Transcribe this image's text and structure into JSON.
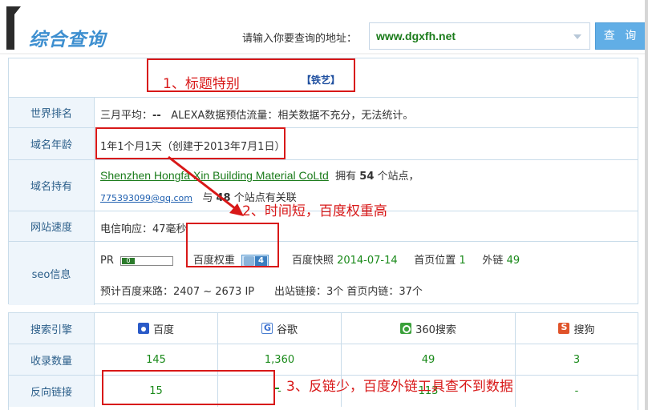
{
  "header": {
    "title": "综合查询",
    "input_label": "请输入你要查询的地址：",
    "url_value": "www.dgxfh.net",
    "query_button": "查 询"
  },
  "site_title_row": {
    "annotation": "1、标题特别",
    "tag": "【铁艺】"
  },
  "world_rank": {
    "label": "世界排名",
    "three_month_avg": "三月平均：",
    "dashes": "--",
    "alexa_text": "ALEXA数据预估流量：相关数据不充分，无法统计。"
  },
  "domain_age": {
    "label": "域名年龄",
    "value": "1年1个月1天（创建于2013年7月1日）"
  },
  "domain_owner": {
    "label": "域名持有",
    "owner_name": "Shenzhen Hongfa Xin Building Material CoLtd",
    "owns_prefix": "拥有",
    "owns_count": "54",
    "owns_suffix": "个站点，",
    "email": "775393099@qq.com",
    "related_prefix": "与",
    "related_count": "48",
    "related_suffix": "个站点有关联"
  },
  "site_speed": {
    "label": "网站速度",
    "telecom": "电信响应：47毫秒"
  },
  "seo": {
    "label": "seo信息",
    "pr_label": "PR",
    "pr_value": "0",
    "baidu_weight_label": "百度权重",
    "baidu_weight_value": "4",
    "snapshot_label": "百度快照",
    "snapshot_date": "2014-07-14",
    "home_pos_label": "首页位置",
    "home_pos_value": "1",
    "outlinks_label": "外链",
    "outlinks_value": "49",
    "est_traffic": "预计百度来路：2407 ~ 2673 IP",
    "outbound_links": "出站链接：3个",
    "internal_links": "首页内链：37个"
  },
  "engines_table": {
    "head_label": "搜索引擎",
    "engines": [
      {
        "name": "百度",
        "icon": "baidu-icon"
      },
      {
        "name": "谷歌",
        "icon": "google-icon"
      },
      {
        "name": "360搜索",
        "icon": "so360-icon"
      },
      {
        "name": "搜狗",
        "icon": "sogou-icon"
      }
    ],
    "indexed_label": "收录数量",
    "indexed": [
      "145",
      "1,360",
      "49",
      "3"
    ],
    "backlinks_label": "反向链接",
    "backlinks": [
      "15",
      "-",
      "113",
      "-"
    ]
  },
  "annotations": {
    "note2": "2、时间短，百度权重高",
    "note3": "3、反链少，百度外链工具查不到数据"
  },
  "colors": {
    "annotation_red": "#d81818",
    "label_blue": "#2c5f8a",
    "value_green": "#1a8a1a",
    "button_blue": "#61aee6"
  }
}
